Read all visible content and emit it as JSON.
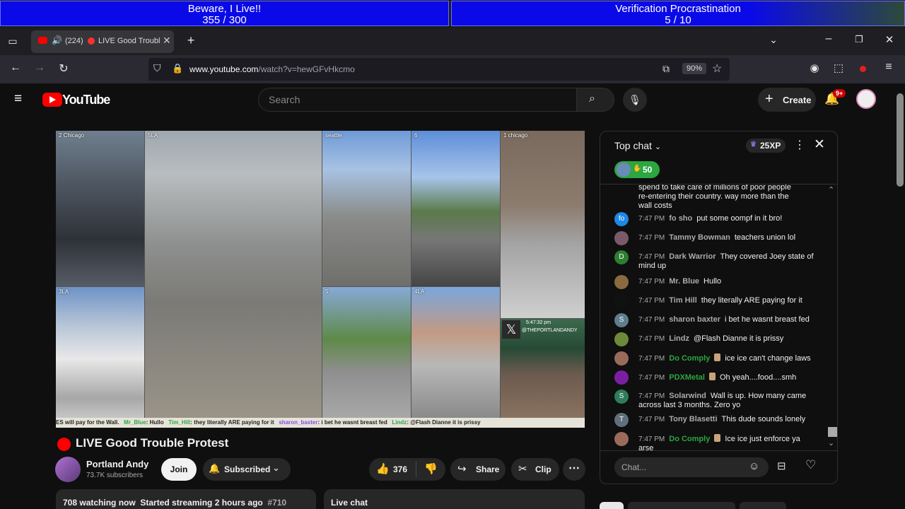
{
  "overlay": {
    "left": {
      "title": "Beware, I Live!!",
      "progress": "355 / 300"
    },
    "right": {
      "title": "Verification Procrastination",
      "progress": "5 / 10"
    }
  },
  "browser": {
    "tab": {
      "count": "(224)",
      "title": "LIVE Good Trouble"
    },
    "url": {
      "domain": "www.youtube.com",
      "path": "/watch?v=hewGFvHkcmo"
    },
    "zoom": "90%"
  },
  "youtube": {
    "logo": "YouTube",
    "search_placeholder": "Search",
    "create_label": "Create",
    "notif_badge": "9+"
  },
  "video": {
    "cells": [
      {
        "label": "2 Chicago"
      },
      {
        "label": "5LA"
      },
      {
        "label": "seattle"
      },
      {
        "label": "6"
      },
      {
        "label": "1 chicago"
      },
      {
        "label": "3LA"
      },
      {
        "label": "5"
      },
      {
        "label": "4LA"
      }
    ],
    "overlay_text": "@THEPORTLANDANDY",
    "overlay_time": "5:47:32 pm",
    "ticker": [
      {
        "user": "",
        "text": "ES will pay for the Wall."
      },
      {
        "user": "Mr_Blue",
        "text": "Hullo"
      },
      {
        "user": "Tim_Hill",
        "text": "they literally ARE paying for it"
      },
      {
        "user": "sharon_baxter",
        "text": "i bet he wasnt breast fed"
      },
      {
        "user": "Lindz",
        "text": "@Flash Dianne it is prissy"
      }
    ]
  },
  "stream": {
    "title": "LIVE Good Trouble Protest",
    "channel": "Portland Andy",
    "subscribers": "73.7K subscribers",
    "join_label": "Join",
    "subscribed_label": "Subscribed",
    "likes": "376",
    "share_label": "Share",
    "clip_label": "Clip",
    "watching": "708 watching now",
    "started": "Started streaming 2 hours ago",
    "hashtag": "#710",
    "live_chat_label": "Live chat"
  },
  "chat": {
    "header": "Top chat",
    "xp": "25XP",
    "pill_count": "50",
    "input_placeholder": "Chat...",
    "partial_message": "spend to take care of millions of poor people re-entering their country. way more than the wall costs",
    "messages": [
      {
        "time": "7:47 PM",
        "author": "fo sho",
        "text": "put some oompf in it bro!",
        "avatar_letter": "fo",
        "avatar_color": "#1e88e5",
        "type": "normal"
      },
      {
        "time": "7:47 PM",
        "author": "Tammy Bowman",
        "text": "teachers union lol",
        "avatar_letter": "",
        "avatar_color": "#7a5a6a",
        "type": "normal"
      },
      {
        "time": "7:47 PM",
        "author": "Dark Warrior",
        "text": "They covered Joey state of mind up",
        "avatar_letter": "D",
        "avatar_color": "#2e7d32",
        "type": "normal"
      },
      {
        "time": "7:47 PM",
        "author": "Mr. Blue",
        "text": "Hullo",
        "avatar_letter": "",
        "avatar_color": "#8a6a40",
        "type": "normal"
      },
      {
        "time": "7:47 PM",
        "author": "Tim Hill",
        "text": "they literally ARE paying for it",
        "avatar_letter": "",
        "avatar_color": "#111111",
        "type": "normal"
      },
      {
        "time": "7:47 PM",
        "author": "sharon baxter",
        "text": "i bet he wasnt breast fed",
        "avatar_letter": "S",
        "avatar_color": "#5f7d8c",
        "type": "normal"
      },
      {
        "time": "7:47 PM",
        "author": "Lindz",
        "text": "@Flash Dianne it is prissy",
        "avatar_letter": "",
        "avatar_color": "#6d8a3a",
        "type": "normal"
      },
      {
        "time": "7:47 PM",
        "author": "Do Comply",
        "text": "ice ice can't change laws",
        "avatar_letter": "",
        "avatar_color": "#9a6a5a",
        "type": "member"
      },
      {
        "time": "7:47 PM",
        "author": "PDXMetal",
        "text": "Oh yeah....food....smh",
        "avatar_letter": "",
        "avatar_color": "#7b1fa2",
        "type": "member"
      },
      {
        "time": "7:47 PM",
        "author": "Solarwind",
        "text": "Wall is up. How many came across last 3 months. Zero yo",
        "avatar_letter": "S",
        "avatar_color": "#2e7d5a",
        "type": "normal"
      },
      {
        "time": "7:47 PM",
        "author": "Tony Blasetti",
        "text": "This dude sounds lonely",
        "avatar_letter": "T",
        "avatar_color": "#5f6f7c",
        "type": "normal"
      },
      {
        "time": "7:47 PM",
        "author": "Do Comply",
        "text": "Ice ice just enforce ya arse",
        "avatar_letter": "",
        "avatar_color": "#9a6a5a",
        "type": "member"
      }
    ]
  },
  "colors": {
    "overlay_blue": "#0a0ae8",
    "yt_red": "#ff0000",
    "member_green": "#2ba640"
  }
}
